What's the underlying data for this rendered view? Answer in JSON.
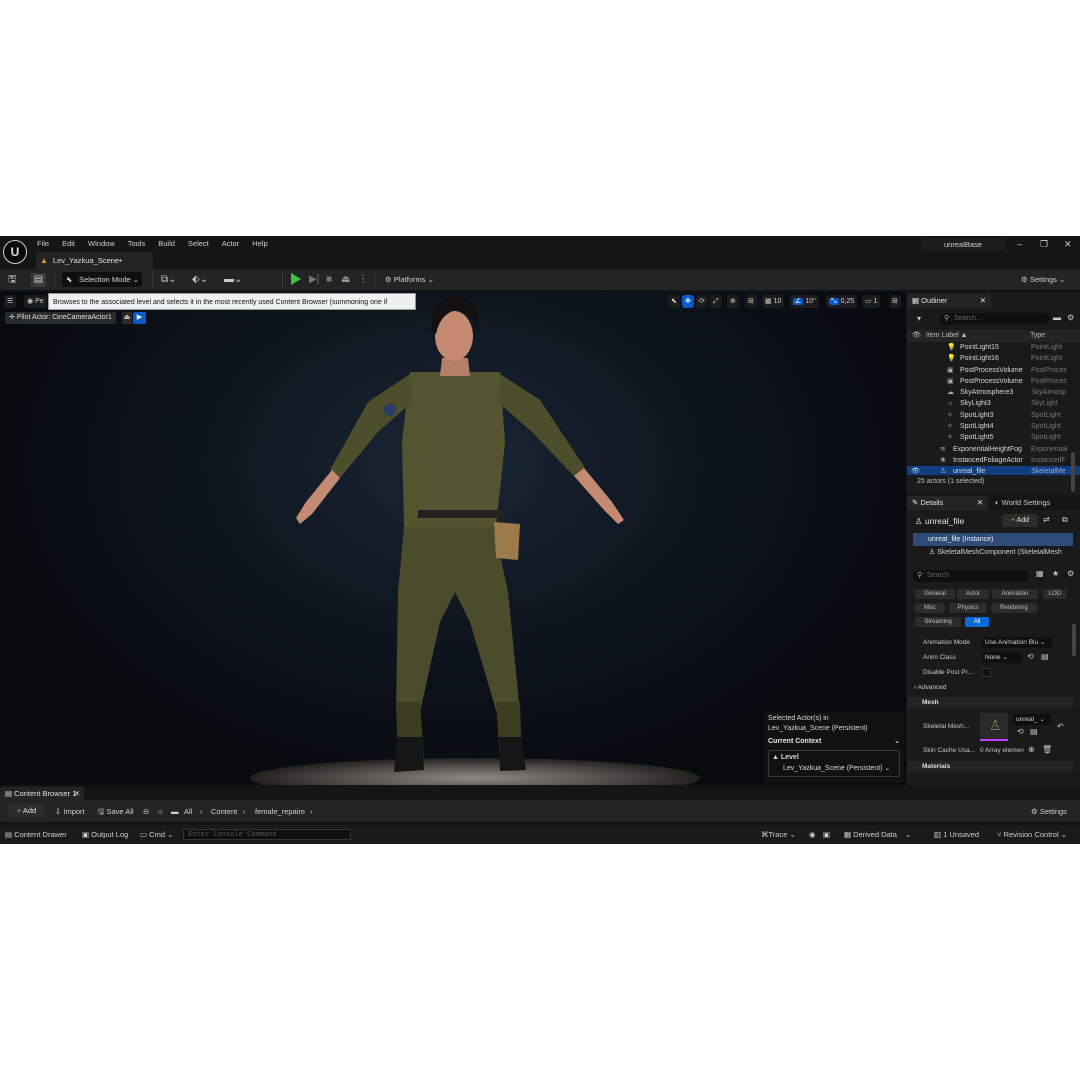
{
  "window": {
    "project_name": "unrealBase",
    "level_tab": "Lev_Yazkua_Scene•"
  },
  "menu": [
    "File",
    "Edit",
    "Window",
    "Tools",
    "Build",
    "Select",
    "Actor",
    "Help"
  ],
  "toolbar": {
    "selection_mode": "Selection Mode",
    "platforms": "Platforms",
    "settings": "Settings"
  },
  "viewport": {
    "perspective_label": "Pe",
    "tooltip": "Browses to the associated level and selects it in the most recently used Content Browser (summoning one if necessary)",
    "pilot_actor": "Pilot Actor: CineCameraActor1",
    "grid_snap": "10",
    "rotation_snap": "10°",
    "scale_snap": "0,25",
    "camera_speed": "1",
    "level_popup": {
      "selected_label": "Selected Actor(s) in",
      "selected_level": "Lev_Yazkua_Scene (Persistent)",
      "context_title": "Current Context",
      "level_header": "Level",
      "level_value": "Lev_Yazkua_Scene (Persistent)"
    }
  },
  "outliner": {
    "tab": "Outliner",
    "search_placeholder": "Search...",
    "col_label": "Item Label ▲",
    "col_type": "Type",
    "rows": [
      {
        "name": "PointLight15",
        "type": "PointLight"
      },
      {
        "name": "PointLight16",
        "type": "PointLight"
      },
      {
        "name": "PostProcessVolume",
        "type": "PostProces"
      },
      {
        "name": "PostProcessVolume",
        "type": "PostProces"
      },
      {
        "name": "SkyAtmosphere3",
        "type": "SkyAtmosp"
      },
      {
        "name": "SkyLight3",
        "type": "SkyLight"
      },
      {
        "name": "SpotLight3",
        "type": "SpotLight"
      },
      {
        "name": "SpotLight4",
        "type": "SpotLight"
      },
      {
        "name": "SpotLight5",
        "type": "SpotLight"
      },
      {
        "name": "ExponentialHeightFog",
        "type": "Exponential"
      },
      {
        "name": "InstancedFoliageActor",
        "type": "InstancedF"
      },
      {
        "name": "unreal_file",
        "type": "SkeletalMe"
      }
    ],
    "footer": "25 actors (1 selected)"
  },
  "details": {
    "tab": "Details",
    "world_settings_tab": "World Settings",
    "actor_name": "unreal_file",
    "add_label": "Add",
    "instance_row": "unreal_file (Instance)",
    "component_row": "SkeletalMeshComponent (SkeletalMesh",
    "search_placeholder": "Search",
    "filters": [
      "General",
      "Actor",
      "Animation",
      "LOD",
      "Misc",
      "Physics",
      "Rendering",
      "Streaming",
      "All"
    ],
    "props": {
      "anim_mode_label": "Animation Mode",
      "anim_mode_value": "Use Animation Blu",
      "anim_class_label": "Anim Class",
      "anim_class_value": "None",
      "disable_pp_label": "Disable Post Pr...",
      "advanced": "Advanced",
      "mesh_cat": "Mesh",
      "skeletal_mesh_label": "Skeletal Mesh...",
      "skeletal_mesh_value": "unreal_",
      "skin_cache_label": "Skin Cache Usa...",
      "skin_cache_value": "0 Array elemen",
      "materials_cat": "Materials"
    }
  },
  "content_browser": {
    "tab": "Content Browser 1",
    "add": "Add",
    "import": "Import",
    "save_all": "Save All",
    "path": [
      "All",
      "Content",
      "female_repaire"
    ],
    "settings": "Settings"
  },
  "status_bar": {
    "content_drawer": "Content Drawer",
    "output_log": "Output Log",
    "cmd": "Cmd",
    "console_placeholder": "Enter Console Command",
    "trace": "Trace",
    "derived_data": "Derived Data",
    "unsaved": "1 Unsaved",
    "revision_control": "Revision Control"
  }
}
